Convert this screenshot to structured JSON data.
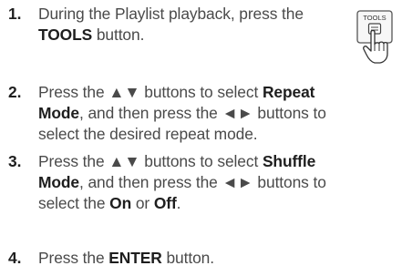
{
  "steps": [
    {
      "number": "1.",
      "line1_prefix": "During the Playlist playback, press the",
      "bold": "TOOLS",
      "suffix": " button."
    },
    {
      "number": "2.",
      "a": "Press the ▲▼ buttons to select ",
      "b": "Repeat",
      "b2": "Mode",
      "c": ", and then press the ◄► buttons to",
      "d": "select the desired repeat mode."
    },
    {
      "number": "3.",
      "a": "Press the ▲▼ buttons to select ",
      "b": "Shuffle",
      "b2": "Mode",
      "c": ", and then press the ◄► buttons to",
      "d1": "select the ",
      "on": "On",
      "d2": " or ",
      "off": "Off",
      "d3": "."
    },
    {
      "number": "4.",
      "a": "Press the ",
      "b": "ENTER",
      "c": " button."
    }
  ],
  "remote_button": {
    "label": "TOOLS",
    "icon": "tools-remote-hand-icon"
  }
}
